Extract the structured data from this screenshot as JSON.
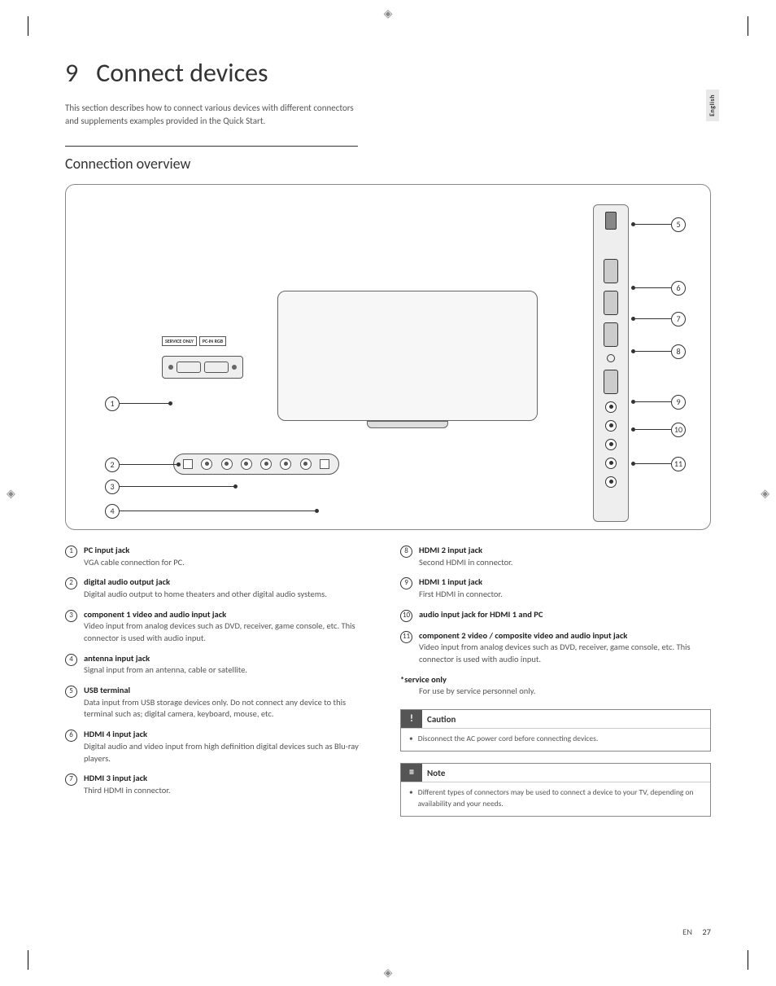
{
  "sideTab": "English",
  "chapter": {
    "number": "9",
    "title": "Connect devices"
  },
  "intro": "This section describes how to connect various devices with different connectors and supplements examples provided in the Quick Start.",
  "sectionTitle": "Connection overview",
  "diagram": {
    "labels": {
      "service": "SERVICE ONLY",
      "pcin": "PC-IN RGB"
    },
    "leftCallouts": [
      "1",
      "2",
      "3",
      "4"
    ],
    "rightCallouts": [
      "5",
      "6",
      "7",
      "8",
      "9",
      "10",
      "11"
    ]
  },
  "leftItems": [
    {
      "num": "1",
      "title": "PC input jack",
      "desc": "VGA cable connection for PC."
    },
    {
      "num": "2",
      "title": "digital audio output jack",
      "desc": "Digital audio output to home theaters and other digital audio systems."
    },
    {
      "num": "3",
      "title": "component 1 video and audio input jack",
      "desc": "Video input from analog devices such as DVD, receiver, game console, etc. This connector is used with audio input."
    },
    {
      "num": "4",
      "title": "antenna input jack",
      "desc": "Signal input from an antenna, cable or satellite."
    },
    {
      "num": "5",
      "title": "USB terminal",
      "desc": "Data input from USB storage devices only. Do not connect any device to this terminal such as; digital camera, keyboard, mouse, etc."
    },
    {
      "num": "6",
      "title": "HDMI 4 input jack",
      "desc": "Digital audio and video input from high definition digital devices such as Blu-ray players."
    },
    {
      "num": "7",
      "title": "HDMI 3 input jack",
      "desc": "Third HDMI in connector."
    }
  ],
  "rightItems": [
    {
      "num": "8",
      "title": "HDMI 2 input jack",
      "desc": "Second HDMI in connector."
    },
    {
      "num": "9",
      "title": "HDMI 1 input jack",
      "desc": "First HDMI in connector."
    },
    {
      "num": "10",
      "title": "audio input jack for HDMI 1 and PC",
      "desc": ""
    },
    {
      "num": "11",
      "title": "component 2 video / composite video and audio input jack",
      "desc": "Video input from analog devices such as DVD, receiver, game console, etc. This connector is used with audio input."
    }
  ],
  "serviceOnly": {
    "title": "*service only",
    "desc": "For use by service personnel only."
  },
  "cautionBox": {
    "label": "Caution",
    "text": "Disconnect the AC power cord before connecting devices."
  },
  "noteBox": {
    "label": "Note",
    "text": "Different types of connectors may be used to connect a device to your TV, depending on availability and your needs."
  },
  "footer": {
    "lang": "EN",
    "page": "27"
  }
}
